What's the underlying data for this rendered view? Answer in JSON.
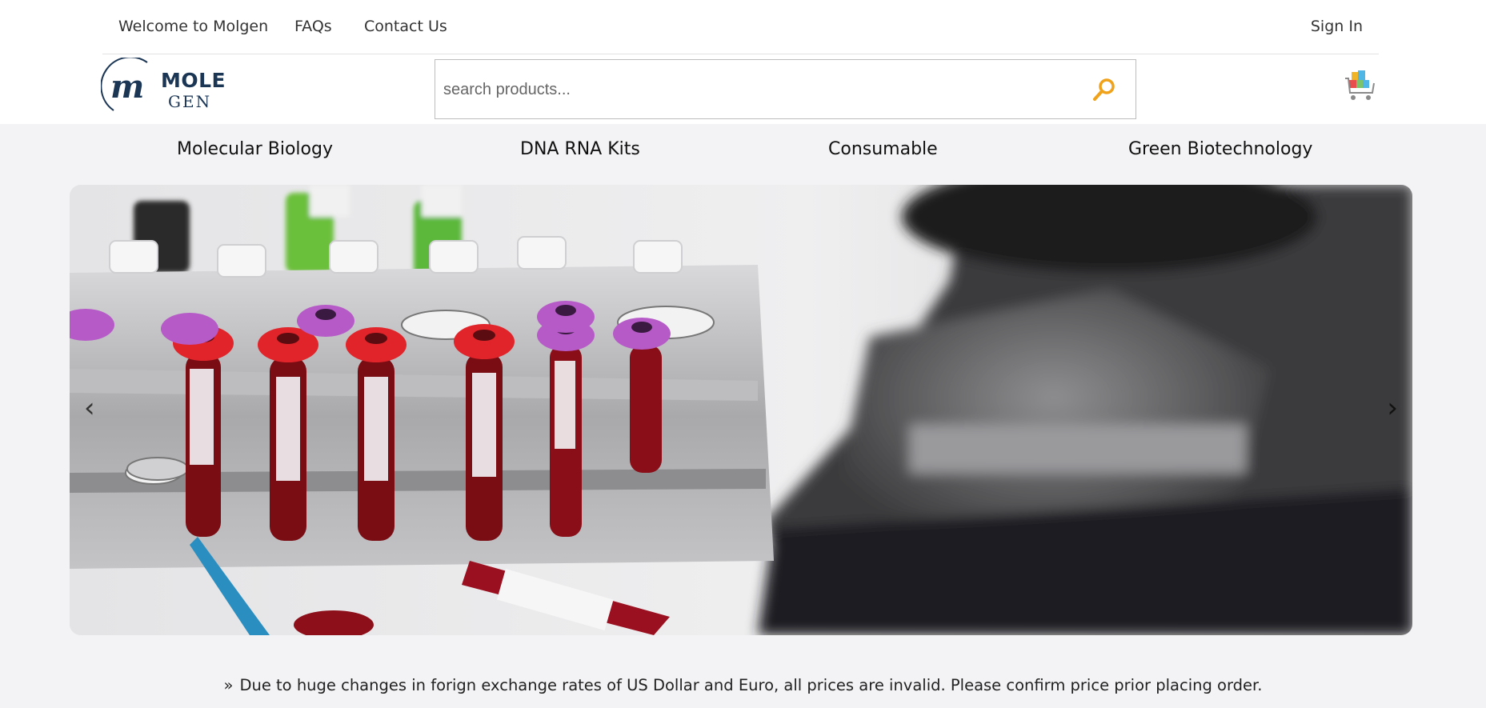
{
  "topbar": {
    "welcome": "Welcome to Molgen",
    "faqs": "FAQs",
    "contact": "Contact Us",
    "signin": "Sign In"
  },
  "logo": {
    "initial": "m",
    "line1": "MOLE",
    "line2": "GEN"
  },
  "search": {
    "placeholder": "search products...",
    "icon": "search-icon"
  },
  "cart": {
    "icon": "cart-icon"
  },
  "categories": [
    {
      "label": "Molecular Biology"
    },
    {
      "label": "DNA RNA Kits"
    },
    {
      "label": "Consumable"
    },
    {
      "label": "Green Biotechnology"
    }
  ],
  "hero": {
    "prev": "‹",
    "next": "›"
  },
  "notice": {
    "chevron": "»",
    "text": "Due to huge changes in forign exchange rates of US Dollar and Euro, all prices are invalid. Please confirm price prior placing order."
  },
  "colors": {
    "brand_navy": "#1b3554",
    "search_icon": "#f0a21a",
    "page_bg": "#f3f3f5"
  }
}
